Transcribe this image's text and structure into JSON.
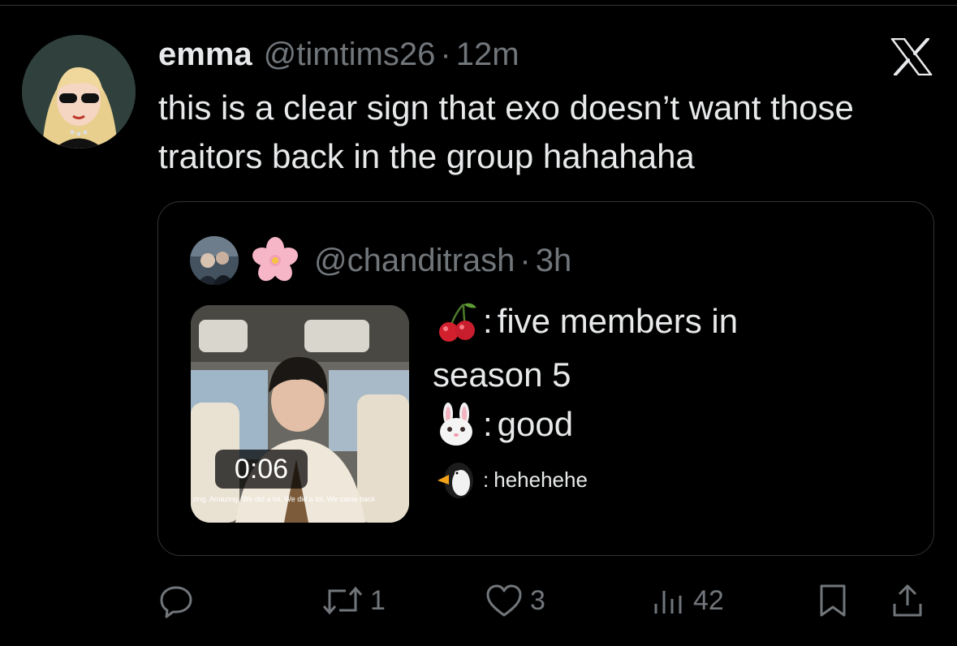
{
  "tweet": {
    "author_name": "emma",
    "author_handle": "@timtims26",
    "separator": "·",
    "timestamp": "12m",
    "text": "this is a clear sign that exo doesn’t want those traitors back in the group hahahaha"
  },
  "quoted_tweet": {
    "author_emoji_name": "cherry-blossom",
    "handle": "@chanditrash",
    "separator": "·",
    "timestamp": "3h",
    "video": {
      "duration": "0:06",
      "caption": "zing. Amazing. We did a lot. We did a lot. We came back"
    },
    "lines": [
      {
        "emoji": "cherries",
        "colon": ":",
        "text": "five members in"
      },
      {
        "emoji": "",
        "colon": "",
        "text": "season 5"
      },
      {
        "emoji": "rabbit-face",
        "colon": ":",
        "text": "good"
      },
      {
        "emoji": "penguin",
        "colon": ":",
        "text": "hehehehe"
      }
    ]
  },
  "actions": {
    "reply_count": "",
    "retweet_count": "1",
    "like_count": "3",
    "view_count": "42"
  },
  "colors": {
    "background": "#000000",
    "text_primary": "#e7e9ea",
    "text_secondary": "#71767b",
    "border": "#2f3336"
  }
}
